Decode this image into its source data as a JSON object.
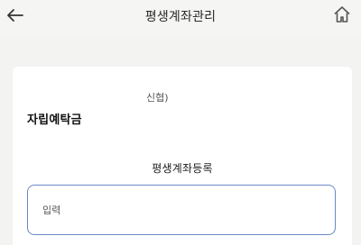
{
  "header": {
    "title": "평생계좌관리",
    "back_icon": "arrow-left-icon",
    "home_icon": "home-icon"
  },
  "account": {
    "bank_text": "신협)",
    "product_name": "자립예탁금"
  },
  "registration": {
    "section_title": "평생계좌등록",
    "input_placeholder": "입력",
    "input_value": ""
  },
  "colors": {
    "background": "#f3f3f1",
    "card": "#ffffff",
    "input_border": "#6a89c7"
  }
}
